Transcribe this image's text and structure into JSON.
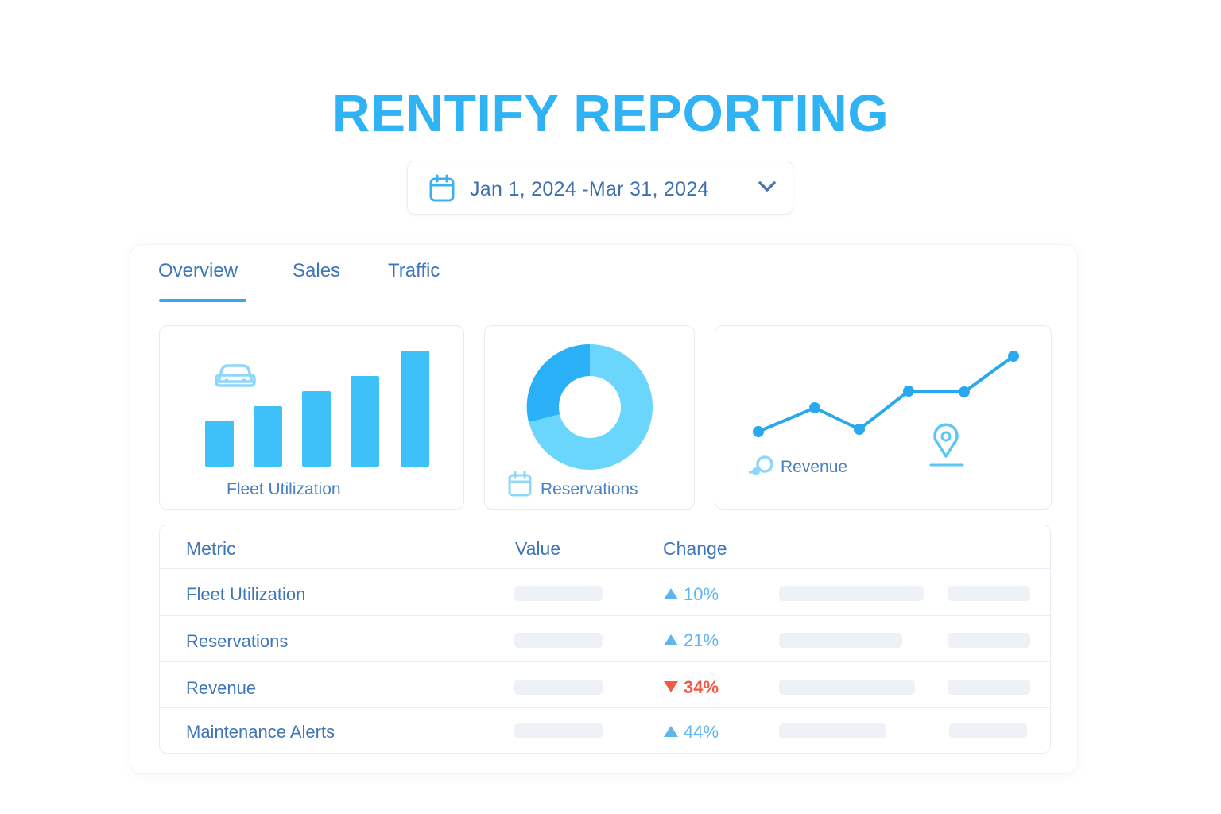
{
  "app": {
    "title": "RENTIFY REPORTING"
  },
  "date_range": {
    "label": "Jan 1, 2024 -Mar 31, 2024"
  },
  "tabs": [
    {
      "label": "Overview",
      "active": true
    },
    {
      "label": "Sales",
      "active": false
    },
    {
      "label": "Traffic",
      "active": false
    }
  ],
  "cards": {
    "fleet": {
      "label": "Fleet Utilization",
      "icon": "car-icon"
    },
    "reservations": {
      "label": "Reservations",
      "icon": "calendar-icon"
    },
    "revenue": {
      "label": "Revenue",
      "icon": "money-icon",
      "extra_icon": "map-pin-icon"
    }
  },
  "table": {
    "headers": {
      "metric": "Metric",
      "value": "Value",
      "change": "Change"
    },
    "rows": [
      {
        "metric": "Fleet Utilization",
        "change": "10%",
        "direction": "up"
      },
      {
        "metric": "Reservations",
        "change": "21%",
        "direction": "up"
      },
      {
        "metric": "Revenue",
        "change": "34%",
        "direction": "down"
      },
      {
        "metric": "Maintenance Alerts",
        "change": "44%",
        "direction": "up"
      }
    ]
  },
  "colors": {
    "accent": "#2fb3f4",
    "bar": "#3ec0f8",
    "donut_light": "#6ad6fc",
    "donut_dark": "#2ab0f6",
    "line": "#2aa8ef",
    "up": "#5fb6ee",
    "down": "#f25b45"
  }
}
